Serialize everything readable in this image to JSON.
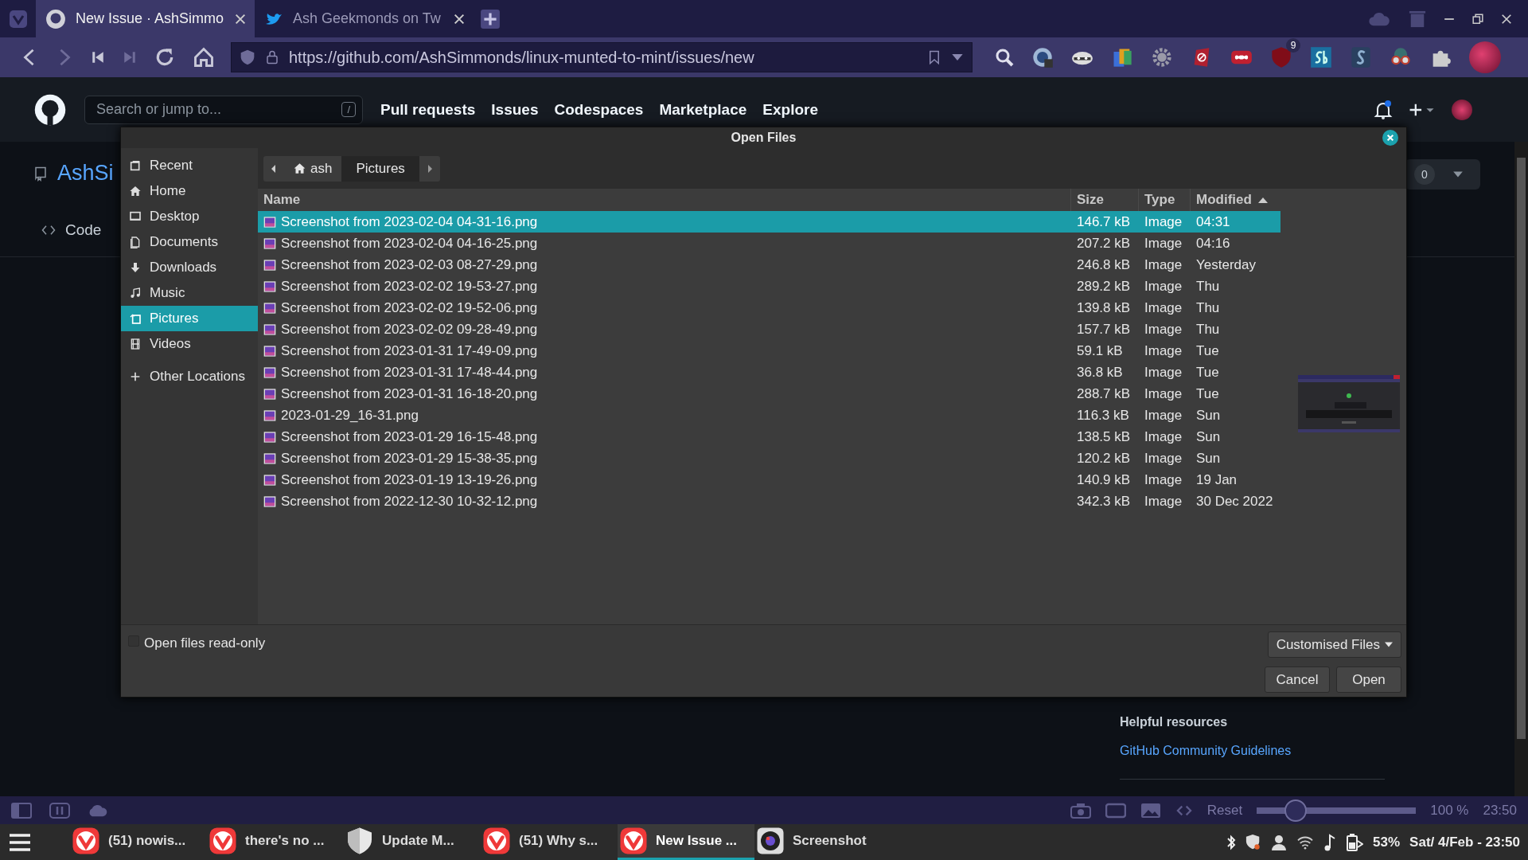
{
  "browser": {
    "tabs": [
      {
        "title": "New Issue · AshSimmo",
        "kind": "github",
        "selected": true
      },
      {
        "title": "Ash Geekmonds on Tw",
        "kind": "bird",
        "selected": false
      }
    ],
    "url": "https://github.com/AshSimmonds/linux-munted-to-mint/issues/new",
    "extension_badge": "9"
  },
  "github": {
    "search": {
      "placeholder": "Search or jump to..."
    },
    "search_key": "/",
    "nav": [
      "Pull requests",
      "Issues",
      "Codespaces",
      "Marketplace",
      "Explore"
    ],
    "repo_title": "AshSi",
    "code_tab": "Code",
    "counter": "0",
    "helpful_title": "Helpful resources",
    "helpful_link": "GitHub Community Guidelines"
  },
  "dialog": {
    "title": "Open Files",
    "path": [
      {
        "label": "ash",
        "selected": false
      },
      {
        "label": "Pictures",
        "selected": true
      }
    ],
    "places": [
      {
        "label": "Recent",
        "kind": "recent",
        "selected": false
      },
      {
        "label": "Home",
        "kind": "home",
        "selected": false
      },
      {
        "label": "Desktop",
        "kind": "desktop",
        "selected": false
      },
      {
        "label": "Documents",
        "kind": "documents",
        "selected": false
      },
      {
        "label": "Downloads",
        "kind": "downloads",
        "selected": false
      },
      {
        "label": "Music",
        "kind": "music",
        "selected": false
      },
      {
        "label": "Pictures",
        "kind": "pictures",
        "selected": true
      },
      {
        "label": "Videos",
        "kind": "videos",
        "selected": false
      },
      {
        "label": "Other Locations",
        "kind": "other",
        "selected": false
      }
    ],
    "columns": [
      {
        "label": "Name",
        "sorted": false
      },
      {
        "label": "Size",
        "sorted": false
      },
      {
        "label": "Type",
        "sorted": false
      },
      {
        "label": "Modified",
        "sorted": true
      }
    ],
    "files": [
      {
        "name": "Screenshot from 2023-02-04 04-31-16.png",
        "size": "146.7 kB",
        "type": "Image",
        "modified": "04:31",
        "selected": true
      },
      {
        "name": "Screenshot from 2023-02-04 04-16-25.png",
        "size": "207.2 kB",
        "type": "Image",
        "modified": "04:16",
        "selected": false
      },
      {
        "name": "Screenshot from 2023-02-03 08-27-29.png",
        "size": "246.8 kB",
        "type": "Image",
        "modified": "Yesterday",
        "selected": false
      },
      {
        "name": "Screenshot from 2023-02-02 19-53-27.png",
        "size": "289.2 kB",
        "type": "Image",
        "modified": "Thu",
        "selected": false
      },
      {
        "name": "Screenshot from 2023-02-02 19-52-06.png",
        "size": "139.8 kB",
        "type": "Image",
        "modified": "Thu",
        "selected": false
      },
      {
        "name": "Screenshot from 2023-02-02 09-28-49.png",
        "size": "157.7 kB",
        "type": "Image",
        "modified": "Thu",
        "selected": false
      },
      {
        "name": "Screenshot from 2023-01-31 17-49-09.png",
        "size": "59.1 kB",
        "type": "Image",
        "modified": "Tue",
        "selected": false
      },
      {
        "name": "Screenshot from 2023-01-31 17-48-44.png",
        "size": "36.8 kB",
        "type": "Image",
        "modified": "Tue",
        "selected": false
      },
      {
        "name": "Screenshot from 2023-01-31 16-18-20.png",
        "size": "288.7 kB",
        "type": "Image",
        "modified": "Tue",
        "selected": false
      },
      {
        "name": "2023-01-29_16-31.png",
        "size": "116.3 kB",
        "type": "Image",
        "modified": "Sun",
        "selected": false
      },
      {
        "name": "Screenshot from 2023-01-29 16-15-48.png",
        "size": "138.5 kB",
        "type": "Image",
        "modified": "Sun",
        "selected": false
      },
      {
        "name": "Screenshot from 2023-01-29 15-38-35.png",
        "size": "120.2 kB",
        "type": "Image",
        "modified": "Sun",
        "selected": false
      },
      {
        "name": "Screenshot from 2023-01-19 13-19-26.png",
        "size": "140.9 kB",
        "type": "Image",
        "modified": "19 Jan",
        "selected": false
      },
      {
        "name": "Screenshot from 2022-12-30 10-32-12.png",
        "size": "342.3 kB",
        "type": "Image",
        "modified": "30 Dec 2022",
        "selected": false
      }
    ],
    "read_only": {
      "label": "Open files read-only",
      "checked": false
    },
    "filter": "Customised Files",
    "buttons": [
      "Cancel",
      "Open"
    ]
  },
  "status_bar": {
    "reset": "Reset",
    "zoom": {
      "level": 0.2
    },
    "zoom_text": "100 %",
    "clock": "23:50"
  },
  "taskbar": {
    "items": [
      {
        "label": "(51) nowis...",
        "kind": "vivaldi",
        "selected": false
      },
      {
        "label": "there's no ...",
        "kind": "vivaldi",
        "selected": false
      },
      {
        "label": "Update M...",
        "kind": "shield",
        "selected": false
      },
      {
        "label": "(51) Why s...",
        "kind": "vivaldi",
        "selected": false
      },
      {
        "label": "New Issue ...",
        "kind": "vivaldi",
        "selected": true
      },
      {
        "label": "Screenshot",
        "kind": "camera",
        "selected": false
      }
    ],
    "battery": "53%",
    "datetime": "Sat/ 4/Feb - 23:50"
  }
}
